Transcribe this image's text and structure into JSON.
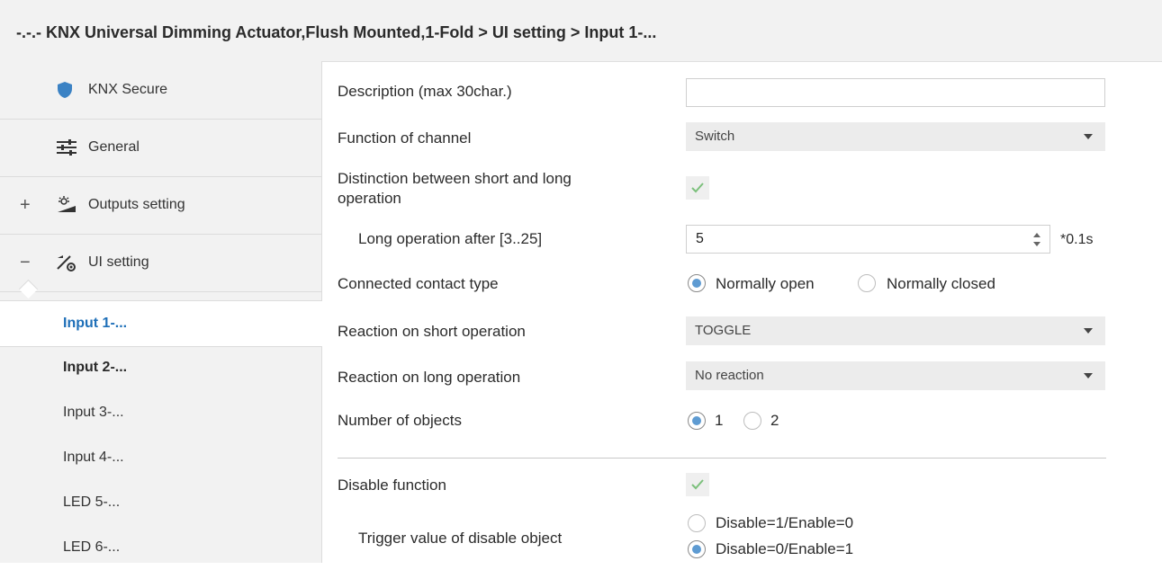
{
  "title": "-.-.- KNX Universal Dimming Actuator,Flush Mounted,1-Fold > UI setting > Input 1-...",
  "sidebar": {
    "items": [
      {
        "label": "KNX Secure",
        "icon": "shield-icon",
        "expander": ""
      },
      {
        "label": "General",
        "icon": "sliders-icon",
        "expander": ""
      },
      {
        "label": "Outputs setting",
        "icon": "dimmer-icon",
        "expander": "+"
      },
      {
        "label": "UI setting",
        "icon": "ui-setting-icon",
        "expander": "−"
      }
    ],
    "sub_items": [
      {
        "label": "Input 1-..."
      },
      {
        "label": "Input 2-..."
      },
      {
        "label": "Input 3-..."
      },
      {
        "label": "Input 4-..."
      },
      {
        "label": "LED 5-..."
      },
      {
        "label": "LED 6-..."
      }
    ]
  },
  "form": {
    "description": {
      "label": "Description (max 30char.)",
      "value": ""
    },
    "function": {
      "label": "Function of channel",
      "value": "Switch"
    },
    "distinction": {
      "label_line1": "Distinction between short and long",
      "label_line2": "operation",
      "checked": true
    },
    "long_operation": {
      "label": "Long operation after [3..25]",
      "value": "5",
      "unit": "*0.1s"
    },
    "contact_type": {
      "label": "Connected contact type",
      "options": [
        "Normally open",
        "Normally closed"
      ],
      "selected": "Normally open"
    },
    "short_reaction": {
      "label": "Reaction on short operation",
      "value": "TOGGLE"
    },
    "long_reaction": {
      "label": "Reaction on long operation",
      "value": "No reaction"
    },
    "objects": {
      "label": "Number of objects",
      "options": [
        "1",
        "2"
      ],
      "selected": "1"
    },
    "disable": {
      "label": "Disable function",
      "checked": true
    },
    "trigger": {
      "label": "Trigger value of disable object",
      "options": [
        "Disable=1/Enable=0",
        "Disable=0/Enable=1"
      ],
      "selected": "Disable=0/Enable=1"
    }
  },
  "colors": {
    "accent": "#1e6fb8",
    "radio_fill": "#5e9bd2",
    "check": "#7cc07c",
    "shield": "#3b82c4"
  }
}
